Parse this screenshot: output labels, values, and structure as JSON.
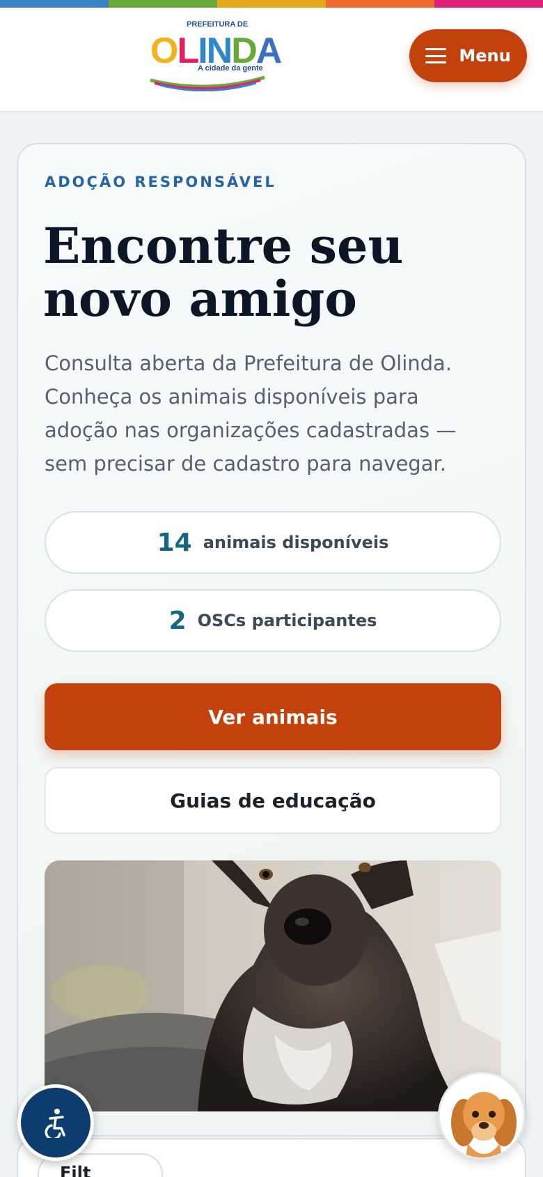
{
  "brand": {
    "colors": [
      "#3b82c4",
      "#6aa83a",
      "#e3a81a",
      "#f06b2d",
      "#e0207a"
    ],
    "logo_top": "PREFEITURA DE",
    "logo_word": "OLINDA",
    "logo_tagline": "A cidade da gente"
  },
  "header": {
    "menu_label": "Menu",
    "menu_icon": "hamburger-icon"
  },
  "hero": {
    "eyebrow": "ADOÇÃO RESPONSÁVEL",
    "title": "Encontre seu novo amigo",
    "lead": "Consulta aberta da Prefeitura de Olinda. Conheça os animais disponíveis para adoção nas organizações cadastradas — sem precisar de cadastro para navegar.",
    "stats": [
      {
        "value": "14",
        "label": "animais disponíveis"
      },
      {
        "value": "2",
        "label": "OSCs participantes"
      }
    ],
    "primary_cta": "Ver animais",
    "secondary_cta": "Guias de educação",
    "accent_color": "#c2410c"
  },
  "bottom": {
    "filter_label": "Filt"
  },
  "floating": {
    "accessibility_icon": "accessibility-icon",
    "mascot_icon": "dog-mascot-icon"
  }
}
